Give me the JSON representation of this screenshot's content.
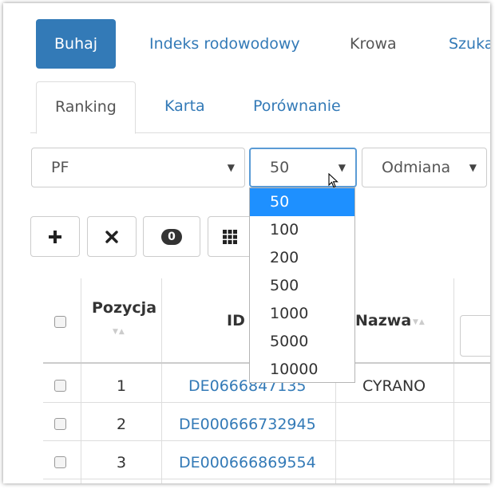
{
  "nav": {
    "pills": [
      {
        "label": "Buhaj"
      },
      {
        "label": "Indeks rodowodowy"
      },
      {
        "label": "Krowa"
      },
      {
        "label": "Szuka"
      }
    ]
  },
  "subtabs": [
    {
      "label": "Ranking"
    },
    {
      "label": "Karta"
    },
    {
      "label": "Porównanie"
    }
  ],
  "filters": {
    "trait": {
      "value": "PF"
    },
    "limit": {
      "value": "50"
    },
    "breed": {
      "value": "Odmiana"
    }
  },
  "limit_dropdown": {
    "options": [
      "50",
      "100",
      "200",
      "500",
      "1000",
      "5000",
      "10000"
    ],
    "selected": "50"
  },
  "toolbar": {
    "add_icon": "plus-icon",
    "remove_icon": "x-icon",
    "count_badge": "0",
    "columns_icon": "grid-icon"
  },
  "table": {
    "headers": {
      "position": "Pozycja",
      "id": "ID",
      "name": "Nazwa"
    },
    "rows": [
      {
        "position": "1",
        "id": "DE0666847135",
        "name": "CYRANO"
      },
      {
        "position": "2",
        "id": "DE000666732945",
        "name": ""
      },
      {
        "position": "3",
        "id": "DE000666869554",
        "name": ""
      }
    ]
  },
  "colors": {
    "accent": "#337ab7",
    "selected_option": "#1e90ff"
  }
}
